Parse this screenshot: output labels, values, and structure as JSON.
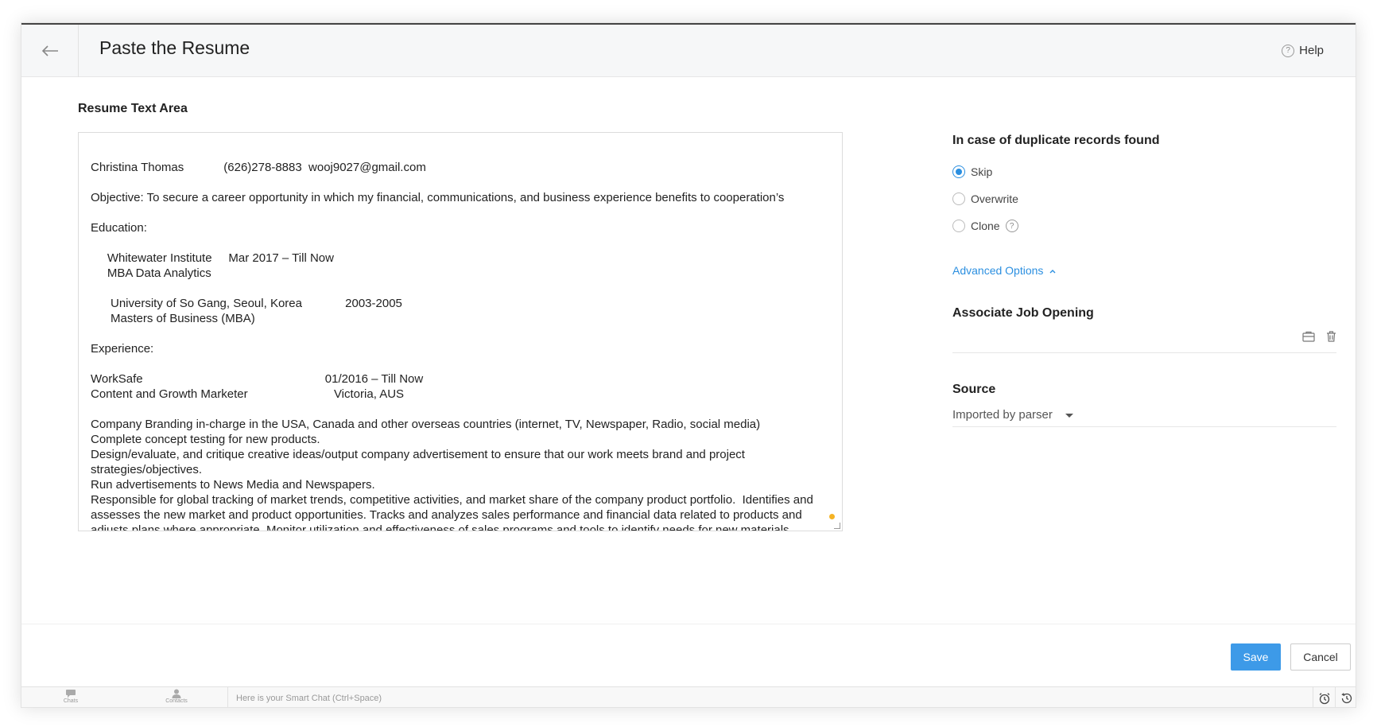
{
  "header": {
    "title": "Paste the Resume",
    "help_label": "Help"
  },
  "resume": {
    "label": "Resume Text Area",
    "lines": [
      "Christina Thomas            (626)278-8883  wooj9027@gmail.com",
      "",
      "Objective: To secure a career opportunity in which my financial, communications, and business experience benefits to cooperation’s",
      "",
      "Education:",
      "",
      "     Whitewater Institute     Mar 2017 – Till Now",
      "     MBA Data Analytics",
      "",
      "      University of So Gang, Seoul, Korea             2003-2005",
      "      Masters of Business (MBA)",
      "",
      "Experience:",
      "",
      "WorkSafe                                                       01/2016 – Till Now",
      "Content and Growth Marketer                          Victoria, AUS",
      "",
      "Company Branding in-charge in the USA, Canada and other overseas countries (internet, TV, Newspaper, Radio, social media)",
      "Complete concept testing for new products.",
      "Design/evaluate, and critique creative ideas/output company advertisement to ensure that our work meets brand and project",
      "strategies/objectives.",
      "Run advertisements to News Media and Newspapers.",
      "Responsible for global tracking of market trends, competitive activities, and market share of the company product portfolio.  Identifies and",
      "assesses the new market and product opportunities. Tracks and analyzes sales performance and financial data related to products and",
      "adjusts plans where appropriate. Monitor utilization and effectiveness of sales programs and tools to identify needs for new materials"
    ]
  },
  "duplicate": {
    "title": "In case of duplicate records found",
    "options": [
      "Skip",
      "Overwrite",
      "Clone"
    ],
    "selected": "Skip"
  },
  "advanced_options_label": "Advanced Options",
  "associate": {
    "title": "Associate Job Opening"
  },
  "source": {
    "title": "Source",
    "value": "Imported by parser"
  },
  "footer": {
    "save_label": "Save",
    "cancel_label": "Cancel"
  },
  "bottom_bar": {
    "chats_label": "Chats",
    "contacts_label": "Contacts",
    "smart_chat_placeholder": "Here is your Smart Chat (Ctrl+Space)"
  },
  "colors": {
    "accent": "#3d9ae8",
    "link": "#2b8fe0",
    "grammar_dot": "#f5b324"
  },
  "icons": [
    "back-arrow-icon",
    "help-icon",
    "info-icon",
    "chevron-up-icon",
    "briefcase-icon",
    "trash-icon",
    "caret-down-icon",
    "chats-icon",
    "contacts-icon",
    "alarm-icon",
    "history-icon"
  ]
}
